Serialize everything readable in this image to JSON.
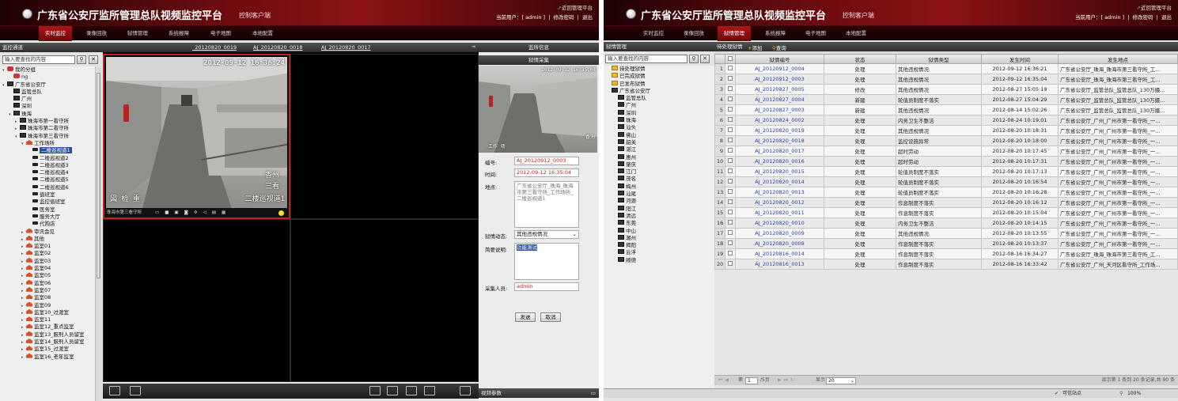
{
  "app": {
    "title": "广东省公安厅监所管理总队视频监控平台",
    "subtitle": "控制客户端",
    "return_link": "近回管理平台",
    "user_prefix": "当前用户：[ ",
    "user": "admin",
    "user_suffix": " ]",
    "change_pwd": "修改密码",
    "logout": "退出"
  },
  "nav": [
    "实时监控",
    "录像回放",
    "狱情管理",
    "系统报障",
    "电子地图",
    "本地配置"
  ],
  "left": {
    "tree_title": "监控通道",
    "search_placeholder": "输入要查找的内容",
    "tree": [
      {
        "label": "我的分组",
        "icon": "group-icon",
        "d": 0,
        "a": "▾"
      },
      {
        "label": "ng",
        "icon": "group-icon",
        "d": 1,
        "a": ""
      },
      {
        "label": "广东省公安厅",
        "icon": "org-icon",
        "d": 0,
        "a": "▾"
      },
      {
        "label": "监管总队",
        "icon": "org-icon",
        "d": 1,
        "a": ""
      },
      {
        "label": "广州",
        "icon": "org-icon",
        "d": 1,
        "a": ""
      },
      {
        "label": "深圳",
        "icon": "org-icon",
        "d": 1,
        "a": ""
      },
      {
        "label": "珠海",
        "icon": "org-icon",
        "d": 1,
        "a": "▾"
      },
      {
        "label": "珠海市第一看守所",
        "icon": "org-icon",
        "d": 2,
        "a": "▸"
      },
      {
        "label": "珠海市第二看守所",
        "icon": "org-icon",
        "d": 2,
        "a": "▸"
      },
      {
        "label": "珠海市第三看守所",
        "icon": "org-icon",
        "d": 2,
        "a": "▾"
      },
      {
        "label": "工作场所",
        "icon": "house-icon",
        "d": 3,
        "a": "▾"
      },
      {
        "label": "二楼巡视道1",
        "icon": "camera-icon",
        "d": 4,
        "a": "",
        "sel": true
      },
      {
        "label": "二楼巡视道2",
        "icon": "camera-icon",
        "d": 4,
        "a": ""
      },
      {
        "label": "二楼巡视道3",
        "icon": "camera-icon",
        "d": 4,
        "a": ""
      },
      {
        "label": "二楼巡视道4",
        "icon": "camera-icon",
        "d": 4,
        "a": ""
      },
      {
        "label": "二楼巡视道5",
        "icon": "camera-icon",
        "d": 4,
        "a": ""
      },
      {
        "label": "二楼巡视道6",
        "icon": "camera-icon",
        "d": 4,
        "a": ""
      },
      {
        "label": "值班室",
        "icon": "camera-icon",
        "d": 4,
        "a": ""
      },
      {
        "label": "监控值班室",
        "icon": "camera-icon",
        "d": 4,
        "a": ""
      },
      {
        "label": "医务室",
        "icon": "camera-icon",
        "d": 4,
        "a": ""
      },
      {
        "label": "服务大厅",
        "icon": "camera-icon",
        "d": 4,
        "a": ""
      },
      {
        "label": "代购店",
        "icon": "camera-icon",
        "d": 4,
        "a": ""
      },
      {
        "label": "审讯会见",
        "icon": "house-icon",
        "d": 3,
        "a": "▸"
      },
      {
        "label": "其他",
        "icon": "house-icon",
        "d": 3,
        "a": "▸"
      },
      {
        "label": "监室01",
        "icon": "house-icon",
        "d": 3,
        "a": "▸"
      },
      {
        "label": "监室02",
        "icon": "house-icon",
        "d": 3,
        "a": "▸"
      },
      {
        "label": "监室03",
        "icon": "house-icon",
        "d": 3,
        "a": "▸"
      },
      {
        "label": "监室04",
        "icon": "house-icon",
        "d": 3,
        "a": "▸"
      },
      {
        "label": "监室05",
        "icon": "house-icon",
        "d": 3,
        "a": "▸"
      },
      {
        "label": "监室06",
        "icon": "house-icon",
        "d": 3,
        "a": "▸"
      },
      {
        "label": "监室07",
        "icon": "house-icon",
        "d": 3,
        "a": "▸"
      },
      {
        "label": "监室08",
        "icon": "house-icon",
        "d": 3,
        "a": "▸"
      },
      {
        "label": "监室09",
        "icon": "house-icon",
        "d": 3,
        "a": "▸"
      },
      {
        "label": "监室10_过渡室",
        "icon": "house-icon",
        "d": 3,
        "a": "▸"
      },
      {
        "label": "监室11",
        "icon": "house-icon",
        "d": 3,
        "a": "▸"
      },
      {
        "label": "监室12_重点监室",
        "icon": "house-icon",
        "d": 3,
        "a": "▸"
      },
      {
        "label": "监室13_服刑人员留室",
        "icon": "house-icon",
        "d": 3,
        "a": "▸"
      },
      {
        "label": "监室14_服刑人员留室",
        "icon": "house-icon",
        "d": 3,
        "a": "▸"
      },
      {
        "label": "监室15_过渡室",
        "icon": "house-icon",
        "d": 3,
        "a": "▸"
      },
      {
        "label": "监室16_老年监室",
        "icon": "house-icon",
        "d": 3,
        "a": "▸"
      }
    ],
    "video_tabs": [
      "_20120820_0019",
      "AJ_20120820_0018",
      "AJ_20120820_0017"
    ],
    "camera": {
      "timestamp": "2012-09-12 16:36:24",
      "osd_right1": "香州",
      "osd_right2": "三看",
      "osd_right3": "二楼巡视道1",
      "osd_left": "図 检 重",
      "toolbar_label": "珠海市第三看守所"
    },
    "info": {
      "header": "监所信息",
      "sub_header": "狱情采集",
      "preview_time": "2012-09-12 16:35:04",
      "preview_osd": "工作 场",
      "preview_osd2": "香洲",
      "labels": {
        "id": "编号:",
        "time": "时间:",
        "place": "地点:",
        "category": "狱情动态:",
        "desc": "简要说明:",
        "collector": "采集人员:"
      },
      "id": "AJ_20120912_0003",
      "time": "2012-09-12 16:35:04",
      "place": "广东省公安厅_珠海_珠海市第三看守所_工作场所_二楼巡视道1",
      "category": "其他违规情况",
      "desc": "功能测试",
      "collector": "admin",
      "send": "发送",
      "cancel": "取消",
      "footer": "视频参数"
    }
  },
  "right": {
    "tree_title": "狱情管理",
    "search_placeholder": "输入要查找的内容",
    "tree": [
      {
        "label": "待处理狱情",
        "icon": "folder-icon",
        "d": 0
      },
      {
        "label": "已完成狱情",
        "icon": "folder-icon",
        "d": 0
      },
      {
        "label": "已发布狱情",
        "icon": "folder-icon",
        "d": 0
      },
      {
        "label": "广东省公安厅",
        "icon": "org-icon",
        "d": 0
      },
      {
        "label": "监管总队",
        "icon": "org-icon",
        "d": 1
      },
      {
        "label": "广州",
        "icon": "org-icon",
        "d": 1
      },
      {
        "label": "深圳",
        "icon": "org-icon",
        "d": 1
      },
      {
        "label": "珠海",
        "icon": "org-icon",
        "d": 1
      },
      {
        "label": "汕头",
        "icon": "org-icon",
        "d": 1
      },
      {
        "label": "佛山",
        "icon": "org-icon",
        "d": 1
      },
      {
        "label": "韶关",
        "icon": "org-icon",
        "d": 1
      },
      {
        "label": "湛江",
        "icon": "org-icon",
        "d": 1
      },
      {
        "label": "惠州",
        "icon": "org-icon",
        "d": 1
      },
      {
        "label": "肇庆",
        "icon": "org-icon",
        "d": 1
      },
      {
        "label": "江门",
        "icon": "org-icon",
        "d": 1
      },
      {
        "label": "茂名",
        "icon": "org-icon",
        "d": 1
      },
      {
        "label": "梅州",
        "icon": "org-icon",
        "d": 1
      },
      {
        "label": "汕尾",
        "icon": "org-icon",
        "d": 1
      },
      {
        "label": "河源",
        "icon": "org-icon",
        "d": 1
      },
      {
        "label": "阳江",
        "icon": "org-icon",
        "d": 1
      },
      {
        "label": "清远",
        "icon": "org-icon",
        "d": 1
      },
      {
        "label": "东莞",
        "icon": "org-icon",
        "d": 1
      },
      {
        "label": "中山",
        "icon": "org-icon",
        "d": 1
      },
      {
        "label": "潮州",
        "icon": "org-icon",
        "d": 1
      },
      {
        "label": "揭阳",
        "icon": "org-icon",
        "d": 1
      },
      {
        "label": "云浮",
        "icon": "org-icon",
        "d": 1
      },
      {
        "label": "顺德",
        "icon": "org-icon",
        "d": 1
      }
    ],
    "list_title": "待处理狱情",
    "add": "添加",
    "query": "查询",
    "columns": [
      "狱情编号",
      "状态",
      "狱情类型",
      "发生时间",
      "发生地点"
    ],
    "rows": [
      [
        "AJ_20120912_0004",
        "处理",
        "其他违规情况",
        "2012-09-12 16:36:21",
        "广东省公安厅_珠海_珠海市第三看守所_工..."
      ],
      [
        "AJ_20120912_0003",
        "处理",
        "其他违规情况",
        "2012-09-12 16:35:04",
        "广东省公安厅_珠海_珠海市第三看守所_工..."
      ],
      [
        "AJ_20120827_0005",
        "修改",
        "其他违规情况",
        "2012-08-27 15:05:19",
        "广东省公安厅_监管总队_监管总队_130万摄..."
      ],
      [
        "AJ_20120827_0004",
        "新建",
        "轮值员制度不落实",
        "2012-08-27 15:04:29",
        "广东省公安厅_监管总队_监管总队_130万摄..."
      ],
      [
        "AJ_20120827_0003",
        "新建",
        "其他违规情况",
        "2012-08-14 15:02:26",
        "广东省公安厅_监管总队_监管总队_130万摄..."
      ],
      [
        "AJ_20120824_0002",
        "处理",
        "内务卫生不整洁",
        "2012-08-24 10:19:01",
        "广东省公安厅_广州_广州市第一看守所_一..."
      ],
      [
        "AJ_20120820_0019",
        "处理",
        "其他违规情况",
        "2012-08-20 10:18:31",
        "广东省公安厅_广州_广州市第一看守所_一..."
      ],
      [
        "AJ_20120820_0018",
        "处理",
        "监控设施异常",
        "2012-08-20 10:18:00",
        "广东省公安厅_广州_广州市第一看守所_一..."
      ],
      [
        "AJ_20120820_0017",
        "处理",
        "超时劳动",
        "2012-08-20 10:17:45",
        "广东省公安厅_广州_广州市第一看守所_一..."
      ],
      [
        "AJ_20120820_0016",
        "处理",
        "超时劳动",
        "2012-08-20 10:17:31",
        "广东省公安厅_广州_广州市第一看守所_一..."
      ],
      [
        "AJ_20120820_0015",
        "处理",
        "轮值员制度不落实",
        "2012-08-20 10:17:13",
        "广东省公安厅_广州_广州市第一看守所_一..."
      ],
      [
        "AJ_20120820_0014",
        "处理",
        "轮值员制度不落实",
        "2012-08-20 10:16:54",
        "广东省公安厅_广州_广州市第一看守所_一..."
      ],
      [
        "AJ_20120820_0013",
        "处理",
        "轮值员制度不落实",
        "2012-08-20 10:16:28",
        "广东省公安厅_广州_广州市第一看守所_一..."
      ],
      [
        "AJ_20120820_0012",
        "处理",
        "作息制度不落实",
        "2012-08-20 10:16:12",
        "广东省公安厅_广州_广州市第一看守所_一..."
      ],
      [
        "AJ_20120820_0011",
        "处理",
        "作息制度不落实",
        "2012-08-20 10:15:04",
        "广东省公安厅_广州_广州市第一看守所_一..."
      ],
      [
        "AJ_20120820_0010",
        "处理",
        "内务卫生不整洁",
        "2012-08-20 10:14:15",
        "广东省公安厅_广州_广州市第一看守所_一..."
      ],
      [
        "AJ_20120820_0009",
        "处理",
        "其他违规情况",
        "2012-08-20 10:13:55",
        "广东省公安厅_广州_广州市第一看守所_一..."
      ],
      [
        "AJ_20120820_0008",
        "处理",
        "作息制度不落实",
        "2012-08-20 10:13:37",
        "广东省公安厅_广州_广州市第一看守所_一..."
      ],
      [
        "AJ_20120816_0014",
        "处理",
        "作息制度不落实",
        "2012-08-16 16:34:27",
        "广东省公安厅_珠海_珠海市第三看守所_工..."
      ],
      [
        "AJ_20120816_0013",
        "处理",
        "作息制度不落实",
        "2012-08-16 16:33:42",
        "广东省公安厅_广州_天河区看守所_工作场..."
      ]
    ],
    "pager": {
      "page_prefix": "第",
      "page": "1",
      "of": "/5页",
      "show": "显示",
      "per_page": "20",
      "summary": "显示第 1 条到 20 条记录,共 90 条"
    },
    "status": {
      "zone": "可信站点",
      "zoom": "100%"
    }
  },
  "colors": {
    "brand": "#8a1217",
    "link": "#2a3fb5",
    "alert": "#c21e1e"
  }
}
